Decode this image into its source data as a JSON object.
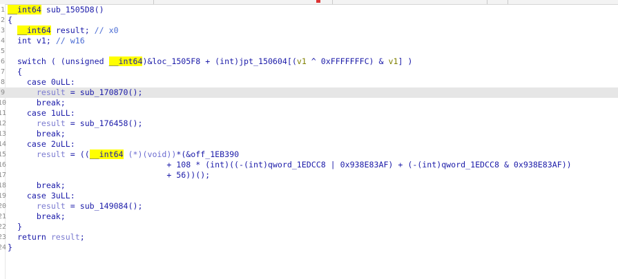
{
  "lines": [
    {
      "n": "1",
      "hl": false,
      "segs": [
        {
          "t": "__int64",
          "c": "yh"
        },
        {
          "t": " sub_1505D8()",
          "c": "pl"
        }
      ]
    },
    {
      "n": "2",
      "hl": false,
      "segs": [
        {
          "t": "{",
          "c": "pl"
        }
      ]
    },
    {
      "n": "3",
      "hl": false,
      "segs": [
        {
          "t": "  ",
          "c": "pl"
        },
        {
          "t": "__int64",
          "c": "yh"
        },
        {
          "t": " result; ",
          "c": "pl"
        },
        {
          "t": "// x0",
          "c": "cmt"
        }
      ]
    },
    {
      "n": "4",
      "hl": false,
      "segs": [
        {
          "t": "  int v1; ",
          "c": "pl"
        },
        {
          "t": "// w16",
          "c": "cmt"
        }
      ]
    },
    {
      "n": "5",
      "hl": false,
      "segs": []
    },
    {
      "n": "6",
      "hl": false,
      "segs": [
        {
          "t": "  switch ( (unsigned ",
          "c": "pl"
        },
        {
          "t": "__int64",
          "c": "yh"
        },
        {
          "t": ")&loc_1505F8 + (int)jpt_150604[(",
          "c": "pl"
        },
        {
          "t": "v1",
          "c": "olive"
        },
        {
          "t": " ^ 0xFFFFFFFC) & ",
          "c": "pl"
        },
        {
          "t": "v1",
          "c": "olive"
        },
        {
          "t": "] )",
          "c": "pl"
        }
      ]
    },
    {
      "n": "7",
      "hl": false,
      "segs": [
        {
          "t": "  {",
          "c": "pl"
        }
      ]
    },
    {
      "n": "8",
      "hl": false,
      "segs": [
        {
          "t": "    case 0uLL:",
          "c": "pl"
        }
      ]
    },
    {
      "n": "9",
      "hl": true,
      "segs": [
        {
          "t": "      ",
          "c": "pl"
        },
        {
          "t": "result",
          "c": "var"
        },
        {
          "t": " = sub_170870();",
          "c": "pl"
        }
      ]
    },
    {
      "n": "10",
      "hl": false,
      "segs": [
        {
          "t": "      break;",
          "c": "pl"
        }
      ]
    },
    {
      "n": "11",
      "hl": false,
      "segs": [
        {
          "t": "    case 1uLL:",
          "c": "pl"
        }
      ]
    },
    {
      "n": "12",
      "hl": false,
      "segs": [
        {
          "t": "      ",
          "c": "pl"
        },
        {
          "t": "result",
          "c": "var"
        },
        {
          "t": " = sub_176458();",
          "c": "pl"
        }
      ]
    },
    {
      "n": "13",
      "hl": false,
      "segs": [
        {
          "t": "      break;",
          "c": "pl"
        }
      ]
    },
    {
      "n": "14",
      "hl": false,
      "segs": [
        {
          "t": "    case 2uLL:",
          "c": "pl"
        }
      ]
    },
    {
      "n": "15",
      "hl": false,
      "segs": [
        {
          "t": "      ",
          "c": "pl"
        },
        {
          "t": "result",
          "c": "var"
        },
        {
          "t": " = ((",
          "c": "pl"
        },
        {
          "t": "__int64",
          "c": "yh"
        },
        {
          "t": " (*)(void))",
          "c": "grey"
        },
        {
          "t": "*(&off_1EB390",
          "c": "pl"
        }
      ]
    },
    {
      "n": "16",
      "hl": false,
      "segs": [
        {
          "t": "                                 + 108 * (int)((-(int)qword_1EDCC8 | 0x938E83AF) + (-(int)qword_1EDCC8 & 0x938E83AF))",
          "c": "pl"
        }
      ]
    },
    {
      "n": "17",
      "hl": false,
      "segs": [
        {
          "t": "                                 + 56))();",
          "c": "pl"
        }
      ]
    },
    {
      "n": "18",
      "hl": false,
      "segs": [
        {
          "t": "      break;",
          "c": "pl"
        }
      ]
    },
    {
      "n": "19",
      "hl": false,
      "segs": [
        {
          "t": "    case 3uLL:",
          "c": "pl"
        }
      ]
    },
    {
      "n": "20",
      "hl": false,
      "segs": [
        {
          "t": "      ",
          "c": "pl"
        },
        {
          "t": "result",
          "c": "var"
        },
        {
          "t": " = sub_149084();",
          "c": "pl"
        }
      ]
    },
    {
      "n": "21",
      "hl": false,
      "segs": [
        {
          "t": "      break;",
          "c": "pl"
        }
      ]
    },
    {
      "n": "22",
      "hl": false,
      "segs": [
        {
          "t": "  }",
          "c": "pl"
        }
      ]
    },
    {
      "n": "23",
      "hl": false,
      "segs": [
        {
          "t": "  return ",
          "c": "pl"
        },
        {
          "t": "result",
          "c": "var"
        },
        {
          "t": ";",
          "c": "pl"
        }
      ]
    },
    {
      "n": "24",
      "hl": false,
      "segs": [
        {
          "t": "}",
          "c": "pl"
        }
      ]
    }
  ]
}
